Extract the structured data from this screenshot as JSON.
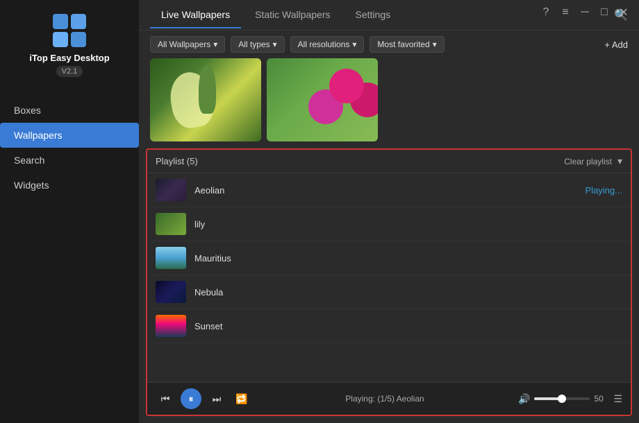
{
  "app": {
    "name": "iTop Easy Desktop",
    "version": "V2.1"
  },
  "sidebar": {
    "items": [
      {
        "id": "boxes",
        "label": "Boxes",
        "active": false
      },
      {
        "id": "wallpapers",
        "label": "Wallpapers",
        "active": true
      },
      {
        "id": "search",
        "label": "Search",
        "active": false
      },
      {
        "id": "widgets",
        "label": "Widgets",
        "active": false
      }
    ]
  },
  "titleBar": {
    "buttons": [
      {
        "id": "help",
        "symbol": "?"
      },
      {
        "id": "menu",
        "symbol": "≡"
      },
      {
        "id": "minimize",
        "symbol": "─"
      },
      {
        "id": "maximize",
        "symbol": "□"
      },
      {
        "id": "close",
        "symbol": "✕"
      }
    ]
  },
  "tabs": [
    {
      "id": "live-wallpapers",
      "label": "Live Wallpapers",
      "active": true
    },
    {
      "id": "static-wallpapers",
      "label": "Static Wallpapers",
      "active": false
    },
    {
      "id": "settings",
      "label": "Settings",
      "active": false
    }
  ],
  "filters": [
    {
      "id": "all-wallpapers",
      "label": "All Wallpapers"
    },
    {
      "id": "all-types",
      "label": "All types"
    },
    {
      "id": "all-resolutions",
      "label": "All resolutions"
    },
    {
      "id": "most-favorited",
      "label": "Most favorited"
    }
  ],
  "addButton": {
    "label": "+ Add"
  },
  "playlist": {
    "title": "Playlist (5)",
    "clearLabel": "Clear playlist",
    "items": [
      {
        "id": "aeolian",
        "name": "Aeolian",
        "thumbClass": "p-thumb-aeolian",
        "status": "Playing..."
      },
      {
        "id": "lily",
        "name": "lily",
        "thumbClass": "p-thumb-lily",
        "status": ""
      },
      {
        "id": "mauritius",
        "name": "Mauritius",
        "thumbClass": "p-thumb-mauritius",
        "status": ""
      },
      {
        "id": "nebula",
        "name": "Nebula",
        "thumbClass": "p-thumb-nebula",
        "status": ""
      },
      {
        "id": "sunset",
        "name": "Sunset",
        "thumbClass": "p-thumb-sunset",
        "status": ""
      }
    ]
  },
  "playback": {
    "playingInfo": "Playing: (1/5) Aeolian",
    "volumePercent": 50,
    "volumeFillWidth": "50%",
    "volumeKnobLeft": "50%"
  }
}
